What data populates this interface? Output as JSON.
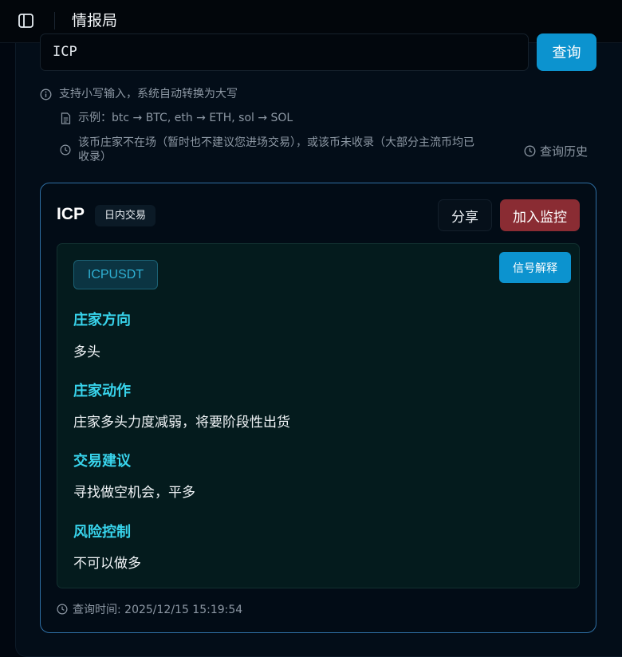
{
  "app": {
    "title": "情报局"
  },
  "search": {
    "value": "ICP",
    "button_label": "查询"
  },
  "hints": {
    "case_note": "支持小写输入，系统自动转换为大写",
    "example": "示例：btc → BTC, eth → ETH, sol → SOL",
    "warning_line1": "该币庄家不在场（暂时也不建议您进场交易），或该币未收录（大部分主流币均已",
    "warning_line2": "收录）",
    "history_label": "查询历史"
  },
  "result": {
    "symbol": "ICP",
    "mode_badge": "日内交易",
    "share_label": "分享",
    "monitor_label": "加入监控",
    "pair": "ICPUSDT",
    "explain_label": "信号解释",
    "sections": [
      {
        "heading": "庄家方向",
        "text": "多头"
      },
      {
        "heading": "庄家动作",
        "text": "庄家多头力度减弱，将要阶段性出货"
      },
      {
        "heading": "交易建议",
        "text": "寻找做空机会，平多"
      },
      {
        "heading": "风险控制",
        "text": "不可以做多"
      }
    ],
    "query_time": "查询时间: 2025/12/15 15:19:54"
  },
  "colors": {
    "accent_blue": "#0c93cf",
    "monitor_red": "#8a2c33",
    "section_heading": "#38d4ec",
    "card_border": "#2e6ea3"
  },
  "icons": [
    "sidebar-toggle-icon",
    "info-icon",
    "document-icon",
    "clock-icon"
  ]
}
